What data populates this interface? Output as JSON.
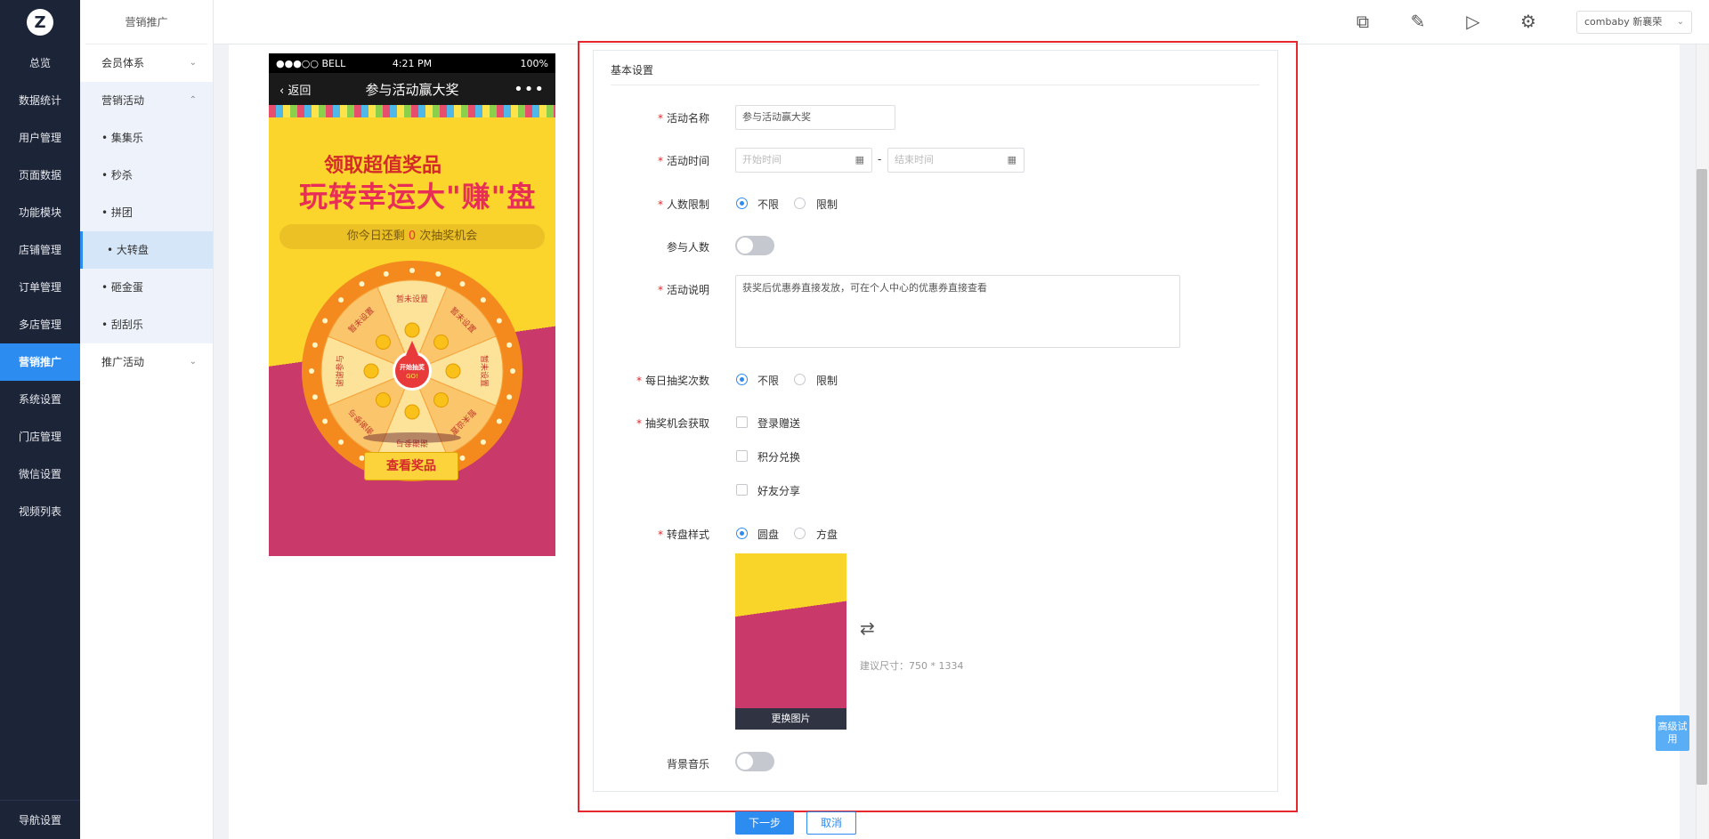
{
  "nav": {
    "items": [
      {
        "label": "总览"
      },
      {
        "label": "数据统计"
      },
      {
        "label": "用户管理"
      },
      {
        "label": "页面数据"
      },
      {
        "label": "功能模块"
      },
      {
        "label": "店铺管理"
      },
      {
        "label": "订单管理"
      },
      {
        "label": "多店管理"
      },
      {
        "label": "营销推广",
        "active": true
      },
      {
        "label": "系统设置"
      },
      {
        "label": "门店管理"
      },
      {
        "label": "微信设置"
      },
      {
        "label": "视频列表"
      }
    ],
    "footer": "导航设置"
  },
  "sub": {
    "title": "营销推广",
    "member": "会员体系",
    "activity": "营销活动",
    "children": [
      "• 集集乐",
      "• 秒杀",
      "• 拼团",
      "• 大转盘",
      "• 砸金蛋",
      "• 刮刮乐"
    ],
    "promo": "推广活动"
  },
  "topbar": {
    "icons": [
      "external-link-icon",
      "edit-icon",
      "play-icon",
      "gear-icon"
    ],
    "store": "combaby 新襄荣"
  },
  "phone": {
    "carrier": "●●●○○ BELL",
    "time": "4:21 PM",
    "battery": "100%",
    "back": "返回",
    "title": "参与活动赢大奖",
    "more": "•••",
    "slogan1": "领取超值奖品",
    "slogan2": "玩转幸运大\"赚\"盘",
    "chances_pre": "你今日还剩 ",
    "chances_num": "0",
    "chances_post": " 次抽奖机会",
    "wheel_segments": [
      "暂未设置",
      "暂未设置",
      "暂未设置",
      "暂未设置",
      "谢谢参与",
      "谢谢参与",
      "谢谢参与",
      "暂未设置"
    ],
    "wheel_center": "开始抽奖",
    "wheel_go": "GO!",
    "view_prize": "查看奖品"
  },
  "form": {
    "section": "基本设置",
    "name_label": "活动名称",
    "name_value": "参与活动赢大奖",
    "time_label": "活动时间",
    "start_ph": "开始时间",
    "end_ph": "结束时间",
    "time_sep": "-",
    "limit_label": "人数限制",
    "unlimited": "不限",
    "limited": "限制",
    "participants_label": "参与人数",
    "desc_label": "活动说明",
    "desc_value": "获奖后优惠券直接发放，可在个人中心的优惠券直接查看",
    "daily_label": "每日抽奖次数",
    "source_label": "抽奖机会获取",
    "sources": [
      "登录赠送",
      "积分兑换",
      "好友分享"
    ],
    "style_label": "转盘样式",
    "style_round": "圆盘",
    "style_square": "方盘",
    "change_image": "更换图片",
    "size_hint": "建议尺寸：750 * 1334",
    "music_label": "背景音乐",
    "next": "下一步",
    "cancel": "取消"
  },
  "advanced": "高级试用",
  "colors": {
    "nav_bg": "#1c2438",
    "accent": "#2d8cf0",
    "highlight": "#e8262b"
  }
}
